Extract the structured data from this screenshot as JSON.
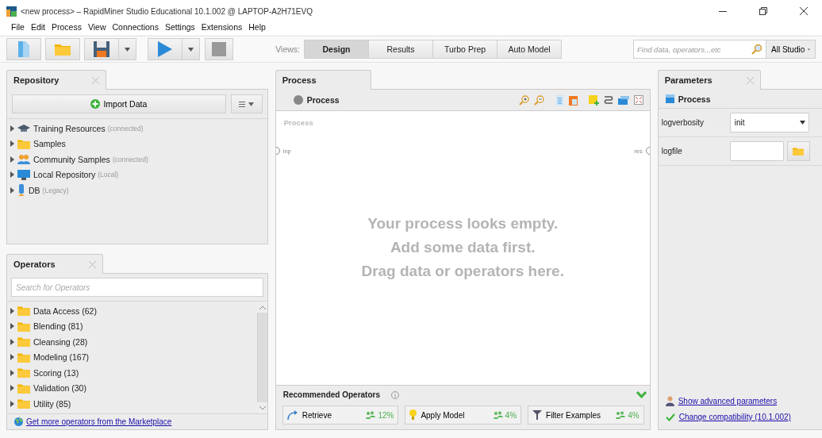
{
  "window": {
    "title": "<new process> – RapidMiner Studio Educational 10.1.002 @ LAPTOP-A2H71EVQ"
  },
  "menu": [
    "File",
    "Edit",
    "Process",
    "View",
    "Connections",
    "Settings",
    "Extensions",
    "Help"
  ],
  "toolbar": {
    "views_label": "Views:",
    "views": [
      {
        "label": "Design",
        "selected": true
      },
      {
        "label": "Results",
        "selected": false
      },
      {
        "label": "Turbo Prep",
        "selected": false
      },
      {
        "label": "Auto Model",
        "selected": false
      }
    ],
    "search": {
      "placeholder": "Find data, operators...etc"
    },
    "scope": "All Studio"
  },
  "repository": {
    "title": "Repository",
    "import_button": "Import Data",
    "items": [
      {
        "kind": "training",
        "name": "Training Resources",
        "note": "(connected)"
      },
      {
        "kind": "folder",
        "name": "Samples"
      },
      {
        "kind": "community",
        "name": "Community Samples",
        "note": "(connected)"
      },
      {
        "kind": "local",
        "name": "Local Repository",
        "note": "(Local)"
      },
      {
        "kind": "db",
        "name": "DB",
        "note": "(Legacy)"
      }
    ]
  },
  "operators": {
    "title": "Operators",
    "search": {
      "placeholder": "Search for Operators"
    },
    "groups": [
      "Data Access (62)",
      "Blending (81)",
      "Cleansing (28)",
      "Modeling (167)",
      "Scoring (13)",
      "Validation (30)",
      "Utility (85)"
    ],
    "marketplace_link": "Get more operators from the Marketplace"
  },
  "process": {
    "tab": "Process",
    "breadcrumb": "Process",
    "canvas_label": "Process",
    "input_port": "inp",
    "output_port": "res",
    "empty_message": [
      "Your process looks empty.",
      "Add some data first.",
      "Drag data or operators here."
    ],
    "recommended": {
      "title": "Recommended Operators",
      "items": [
        {
          "kind": "retrieve",
          "name": "Retrieve",
          "share": "12%"
        },
        {
          "kind": "apply",
          "name": "Apply Model",
          "share": "4%"
        },
        {
          "kind": "filter",
          "name": "Filter Examples",
          "share": "4%"
        }
      ]
    }
  },
  "parameters": {
    "title": "Parameters",
    "operator": "Process",
    "rows": [
      {
        "kind": "select",
        "label": "logverbosity",
        "value": "init"
      },
      {
        "kind": "file",
        "label": "logfile"
      }
    ],
    "advanced_link": "Show advanced parameters",
    "compat_link": "Change compatibility (10.1.002)"
  }
}
